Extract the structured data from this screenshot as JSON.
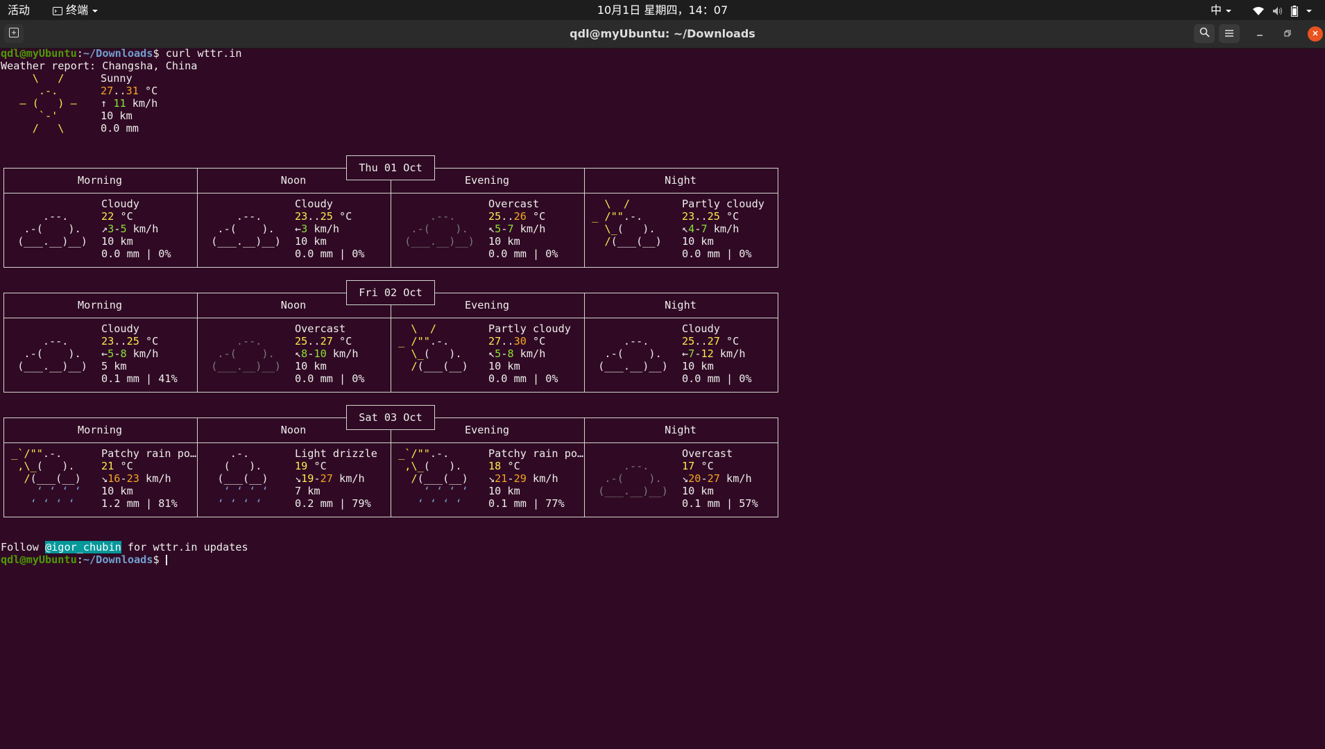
{
  "topbar": {
    "activities": "活动",
    "app_menu": "终端",
    "datetime": "10月1日 星期四，14：07",
    "input_method": "中"
  },
  "header": {
    "title": "qdl@myUbuntu: ~/Downloads"
  },
  "terminal": {
    "prompt_user": "qdl@myUbuntu",
    "prompt_sep": ":",
    "prompt_path": "~/Downloads",
    "prompt_dollar": "$",
    "command": " curl wttr.in",
    "report_title": "Weather report: Changsha, China",
    "current": {
      "condition": "Sunny",
      "temp_low": "27",
      "temp_high": "31",
      "temp_unit": " °C",
      "wind_arrow": "↑",
      "wind_speed": "11",
      "wind_unit": " km/h",
      "visibility": "10 km",
      "precip": "0.0 mm"
    },
    "period_labels": [
      "Morning",
      "Noon",
      "Evening",
      "Night"
    ],
    "days": [
      {
        "date": "Thu 01 Oct",
        "periods": [
          {
            "condition": "Cloudy",
            "t1": "22",
            "t2": "",
            "arrow": "↗",
            "w1": "3",
            "w2": "5",
            "vis": "10 km",
            "precip": "0.0 mm | 0%"
          },
          {
            "condition": "Cloudy",
            "t1": "23",
            "t2": "25",
            "arrow": "←",
            "w1": "3",
            "w2": "",
            "vis": "10 km",
            "precip": "0.0 mm | 0%"
          },
          {
            "condition": "Overcast",
            "t1": "25",
            "t2": "26",
            "arrow": "↖",
            "w1": "5",
            "w2": "7",
            "vis": "10 km",
            "precip": "0.0 mm | 0%"
          },
          {
            "condition": "Partly cloudy",
            "t1": "23",
            "t2": "25",
            "arrow": "↖",
            "w1": "4",
            "w2": "7",
            "vis": "10 km",
            "precip": "0.0 mm | 0%"
          }
        ]
      },
      {
        "date": "Fri 02 Oct",
        "periods": [
          {
            "condition": "Cloudy",
            "t1": "23",
            "t2": "25",
            "arrow": "←",
            "w1": "5",
            "w2": "8",
            "vis": "5 km",
            "precip": "0.1 mm | 41%"
          },
          {
            "condition": "Overcast",
            "t1": "25",
            "t2": "27",
            "arrow": "↖",
            "w1": "8",
            "w2": "10",
            "vis": "10 km",
            "precip": "0.0 mm | 0%"
          },
          {
            "condition": "Partly cloudy",
            "t1": "27",
            "t2": "30",
            "arrow": "↖",
            "w1": "5",
            "w2": "8",
            "vis": "10 km",
            "precip": "0.0 mm | 0%"
          },
          {
            "condition": "Cloudy",
            "t1": "25",
            "t2": "27",
            "arrow": "←",
            "w1": "7",
            "w2": "12",
            "vis": "10 km",
            "precip": "0.0 mm | 0%"
          }
        ]
      },
      {
        "date": "Sat 03 Oct",
        "periods": [
          {
            "condition": "Patchy rain po…",
            "t1": "21",
            "t2": "",
            "arrow": "↘",
            "w1": "16",
            "w2": "23",
            "vis": "10 km",
            "precip": "1.2 mm | 81%"
          },
          {
            "condition": "Light drizzle",
            "t1": "19",
            "t2": "",
            "arrow": "↘",
            "w1": "19",
            "w2": "27",
            "vis": "7 km",
            "precip": "0.2 mm | 79%"
          },
          {
            "condition": "Patchy rain po…",
            "t1": "18",
            "t2": "",
            "arrow": "↘",
            "w1": "21",
            "w2": "29",
            "vis": "10 km",
            "precip": "0.1 mm | 77%"
          },
          {
            "condition": "Overcast",
            "t1": "17",
            "t2": "",
            "arrow": "↘",
            "w1": "20",
            "w2": "27",
            "vis": "10 km",
            "precip": "0.1 mm | 57%"
          }
        ]
      }
    ],
    "follow_prefix": "Follow ",
    "follow_handle": "@igor_chubin",
    "follow_suffix": " for wttr.in updates"
  },
  "colors": {
    "background": "#300a24",
    "prompt_user": "#4e9a06",
    "prompt_path": "#729fcf",
    "temp_yellow": "#fce94f",
    "temp_orange": "#f5a623",
    "wind_green": "#8ae234",
    "highlight": "#06989a"
  },
  "icons": [
    "activities-terminal-icon",
    "wifi-icon",
    "volume-icon",
    "battery-icon",
    "new-tab-icon",
    "search-icon",
    "hamburger-menu-icon",
    "minimize-icon",
    "restore-icon",
    "close-icon"
  ]
}
